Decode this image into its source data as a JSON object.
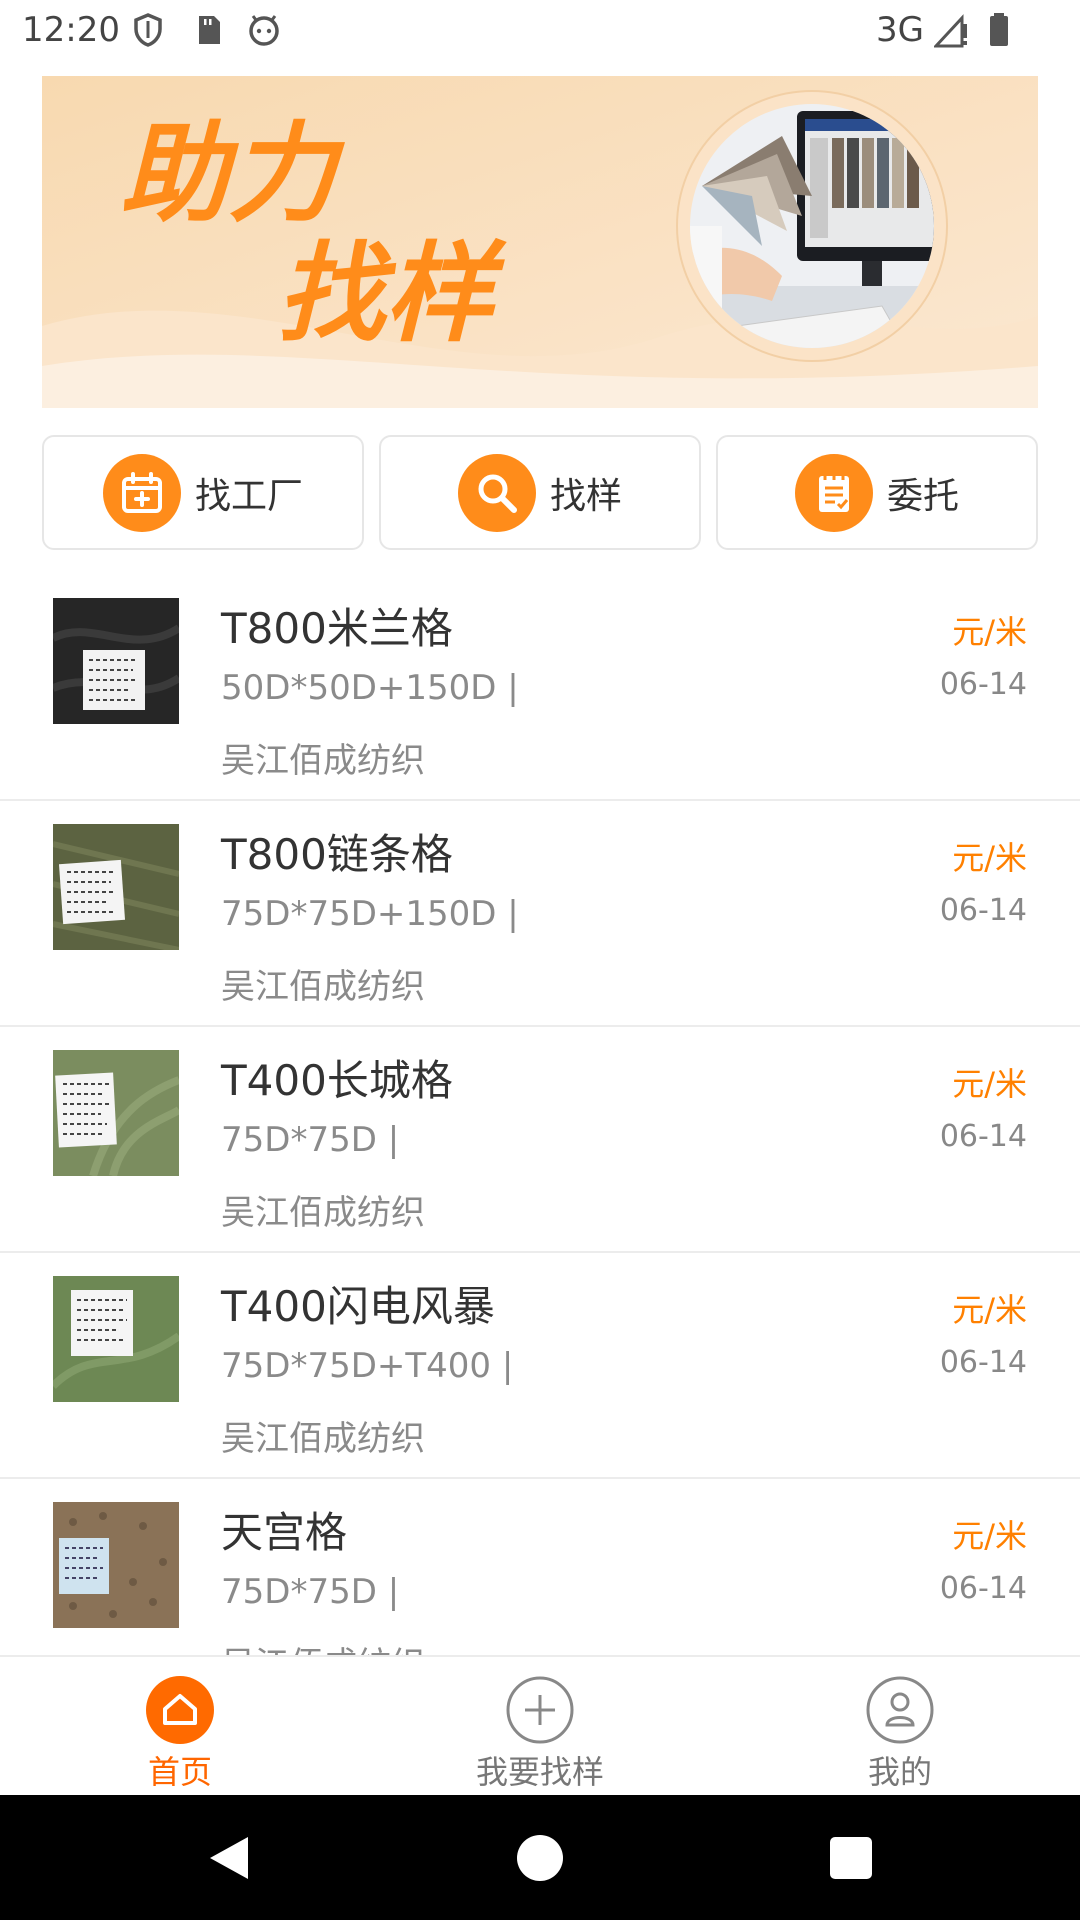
{
  "status_bar": {
    "time": "12:20",
    "network": "3G",
    "icons": [
      "shield-icon",
      "sd-card-icon",
      "android-face-icon",
      "signal-icon",
      "battery-icon"
    ]
  },
  "banner": {
    "line1": "助力",
    "line2": "找样",
    "colors": {
      "accent": "#ff8c1a",
      "background": "#f8dfbd"
    }
  },
  "actions": [
    {
      "label": "找工厂",
      "icon": "calendar-add-icon"
    },
    {
      "label": "找样",
      "icon": "search-icon"
    },
    {
      "label": "委托",
      "icon": "document-check-icon"
    }
  ],
  "items": [
    {
      "name": "T800米兰格",
      "spec": "50D*50D+150D |",
      "company": "吴江佰成纺织",
      "price": "元/米",
      "date": "06-14",
      "swatch": "#2a2a2a"
    },
    {
      "name": "T800链条格",
      "spec": "75D*75D+150D |",
      "company": "吴江佰成纺织",
      "price": "元/米",
      "date": "06-14",
      "swatch": "#5b6140"
    },
    {
      "name": "T400长城格",
      "spec": "75D*75D |",
      "company": "吴江佰成纺织",
      "price": "元/米",
      "date": "06-14",
      "swatch": "#7d9060"
    },
    {
      "name": "T400闪电风暴",
      "spec": "75D*75D+T400 |",
      "company": "吴江佰成纺织",
      "price": "元/米",
      "date": "06-14",
      "swatch": "#6f8a55"
    },
    {
      "name": "天宫格",
      "spec": "75D*75D |",
      "company": "吴江佰成纺织",
      "price": "元/米",
      "date": "06-14",
      "swatch": "#8b7358"
    }
  ],
  "tabbar": {
    "tabs": [
      {
        "label": "首页",
        "icon": "home-icon",
        "active": true
      },
      {
        "label": "我要找样",
        "icon": "plus-circle-icon",
        "active": false
      },
      {
        "label": "我的",
        "icon": "user-icon",
        "active": false
      }
    ]
  },
  "colors": {
    "primary": "#ff8000",
    "muted": "#8a8a8a"
  }
}
